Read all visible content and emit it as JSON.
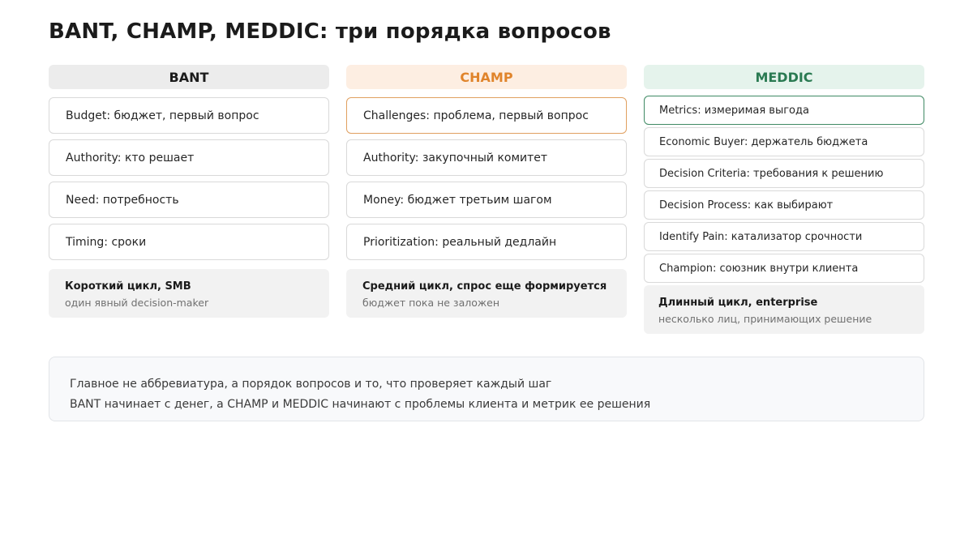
{
  "title": "BANT, CHAMP, MEDDIC: три порядка вопросов",
  "columns": [
    {
      "name": "BANT",
      "items": [
        "Budget: бюджет, первый вопрос",
        "Authority: кто решает",
        "Need: потребность",
        "Timing: сроки"
      ],
      "note_title": "Короткий цикл, SMB",
      "note_sub": "один явный decision-maker"
    },
    {
      "name": "CHAMP",
      "items": [
        "Challenges: проблема, первый вопрос",
        "Authority: закупочный комитет",
        "Money: бюджет третьим шагом",
        "Prioritization: реальный дедлайн"
      ],
      "note_title": "Средний цикл, спрос еще формируется",
      "note_sub": "бюджет пока не заложен"
    },
    {
      "name": "MEDDIC",
      "items": [
        "Metrics: измеримая выгода",
        "Economic Buyer: держатель бюджета",
        "Decision Criteria: требования к решению",
        "Decision Process: как выбирают",
        "Identify Pain: катализатор срочности",
        "Champion: союзник внутри клиента"
      ],
      "note_title": "Длинный цикл, enterprise",
      "note_sub": "несколько лиц, принимающих решение"
    }
  ],
  "summary": {
    "line1": "Главное не аббревиатура, а порядок вопросов и то, что проверяет каждый шаг",
    "line2": "BANT начинает с денег, а CHAMP и MEDDIC начинают с проблемы клиента и метрик ее решения"
  },
  "colors": {
    "bant_header": "#1b1b1b",
    "champ_accent": "#e0842b",
    "meddic_accent": "#2a7a52"
  }
}
